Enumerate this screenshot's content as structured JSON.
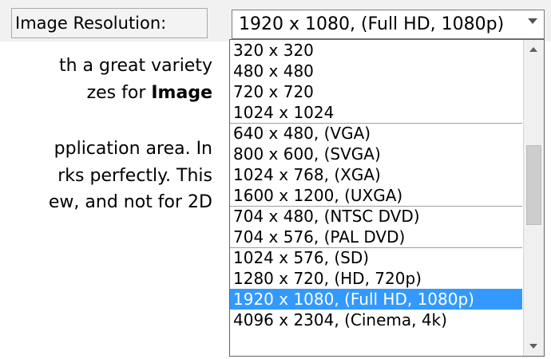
{
  "settings": {
    "label": "Image Resolution:",
    "selected_value": "1920 x 1080, (Full HD, 1080p)",
    "icons": {
      "dropdown": "chevron-down-icon",
      "scroll_up": "arrow-up-icon",
      "scroll_down": "arrow-down-icon"
    }
  },
  "doc_text": [
    {
      "before": "th a great variety",
      "bold": ""
    },
    {
      "before": "zes  for  ",
      "bold": "Image"
    },
    {
      "before": "pplication area. In",
      "bold": ""
    },
    {
      "before": "rks perfectly. This",
      "bold": ""
    },
    {
      "before": "ew, and not for 2D",
      "bold": ""
    }
  ],
  "options": [
    {
      "label": "320 x 320"
    },
    {
      "label": "480 x 480"
    },
    {
      "label": "720 x 720"
    },
    {
      "label": "1024 x 1024"
    },
    {
      "label": "640 x 480, (VGA)"
    },
    {
      "label": "800 x 600, (SVGA)"
    },
    {
      "label": "1024 x 768, (XGA)"
    },
    {
      "label": "1600 x 1200, (UXGA)"
    },
    {
      "label": "704 x 480, (NTSC DVD)"
    },
    {
      "label": "704 x 576, (PAL  DVD)"
    },
    {
      "label": "1024 x 576, (SD)"
    },
    {
      "label": "1280 x 720, (HD, 720p)"
    },
    {
      "label": "1920 x 1080, (Full HD, 1080p)"
    },
    {
      "label": "4096 x 2304, (Cinema, 4k)"
    }
  ],
  "colors": {
    "selection": "#3399ff",
    "selection_text": "#ffffff"
  }
}
